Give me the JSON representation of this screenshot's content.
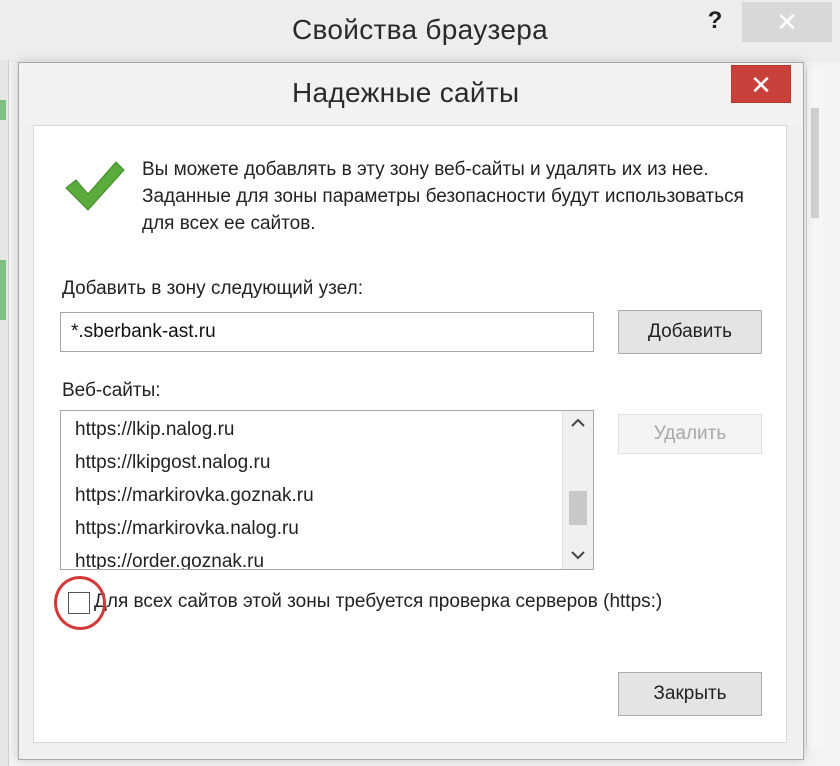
{
  "parent_window": {
    "title": "Свойства браузера",
    "help_label": "?",
    "close_label": "✕"
  },
  "dialog": {
    "title": "Надежные сайты",
    "close_label": "✕",
    "intro_text": "Вы можете добавлять в эту зону  веб-сайты и удалять их из нее. Заданные для зоны параметры безопасности будут использоваться для всех ее сайтов.",
    "add_label": "Добавить в зону следующий узел:",
    "add_value": "*.sberbank-ast.ru",
    "add_button": "Добавить",
    "websites_label": "Веб-сайты:",
    "websites": [
      "https://lkip.nalog.ru",
      "https://lkipgost.nalog.ru",
      "https://markirovka.goznak.ru",
      "https://markirovka.nalog.ru",
      "https://order.goznak.ru"
    ],
    "remove_button": "Удалить",
    "https_checkbox_label": "Для всех сайтов этой зоны требуется проверка серверов (https:)",
    "https_checked": false,
    "close_button": "Закрыть"
  },
  "colors": {
    "close_red": "#c9413a",
    "check_green": "#5aaa3c",
    "annotation_red": "#d23a3a"
  },
  "icons": {
    "check": "check-icon",
    "scroll_up": "chevron-up-icon",
    "scroll_down": "chevron-down-icon"
  }
}
